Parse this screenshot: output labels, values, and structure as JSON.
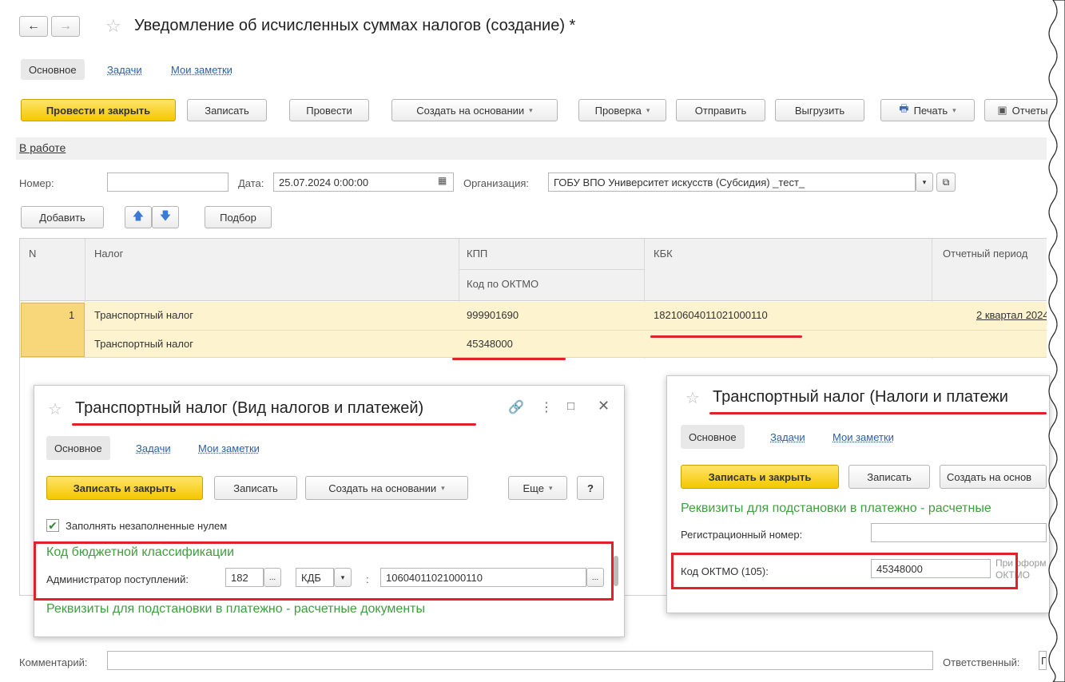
{
  "window": {
    "title": "Уведомление об исчисленных суммах налогов (создание) *",
    "tabs": [
      "Основное",
      "Задачи",
      "Мои заметки"
    ],
    "toolbar": {
      "post_close": "Провести и закрыть",
      "save": "Записать",
      "post": "Провести",
      "create_based": "Создать на основании",
      "check": "Проверка",
      "send": "Отправить",
      "export": "Выгрузить",
      "print": "Печать",
      "reports": "Отчеты"
    },
    "status": "В работе",
    "form": {
      "number_label": "Номер:",
      "number_value": "",
      "date_label": "Дата:",
      "date_value": "25.07.2024  0:00:00",
      "org_label": "Организация:",
      "org_value": "ГОБУ ВПО Университет искусств (Субсидия) _тест_"
    },
    "table_toolbar": {
      "add": "Добавить",
      "select": "Подбор"
    },
    "table": {
      "headers": {
        "n": "N",
        "tax": "Налог",
        "kpp": "КПП",
        "oktmo": "Код по ОКТМО",
        "kbk": "КБК",
        "period": "Отчетный период"
      },
      "row": {
        "n": "1",
        "tax": "Транспортный налог",
        "tax2": "Транспортный налог",
        "kpp": "999901690",
        "oktmo": "45348000",
        "kbk": "18210604011021000110",
        "period": "2 квартал 2024"
      }
    },
    "comment_label": "Комментарий:",
    "comment_value": "",
    "responsible_label": "Ответственный:",
    "responsible_value": "Гла"
  },
  "dialog1": {
    "title": "Транспортный налог (Вид налогов и платежей)",
    "tabs": [
      "Основное",
      "Задачи",
      "Мои заметки"
    ],
    "save_close": "Записать и закрыть",
    "save": "Записать",
    "create_based": "Создать на основании",
    "more": "Еще",
    "help": "?",
    "checkbox_label": "Заполнять незаполненные нулем",
    "section_kbk": "Код бюджетной классификации",
    "admin_label": "Администратор поступлений:",
    "admin_value": "182",
    "kdb_value": "КДБ",
    "colon": ":",
    "kbk_rest": "10604011021000110",
    "section_req": "Реквизиты для подстановки в платежно - расчетные документы"
  },
  "dialog2": {
    "title": "Транспортный налог (Налоги и платежи",
    "tabs": [
      "Основное",
      "Задачи",
      "Мои заметки"
    ],
    "save_close": "Записать и закрыть",
    "save": "Записать",
    "create_based": "Создать на основ",
    "section_req": "Реквизиты для подстановки в платежно - расчетные",
    "reg_label": "Регистрационный номер:",
    "reg_value": "",
    "oktmo_label": "Код ОКТМО (105):",
    "oktmo_value": "45348000",
    "note_line1": "При оформ",
    "note_line2": "ОКТМО"
  },
  "colors": {
    "accent_yellow": "#f4c800",
    "row_highlight": "#fdf3cf",
    "annotation_red": "#e0202a",
    "green_heading": "#3f9e3f",
    "link_blue": "#2b5fa8"
  }
}
